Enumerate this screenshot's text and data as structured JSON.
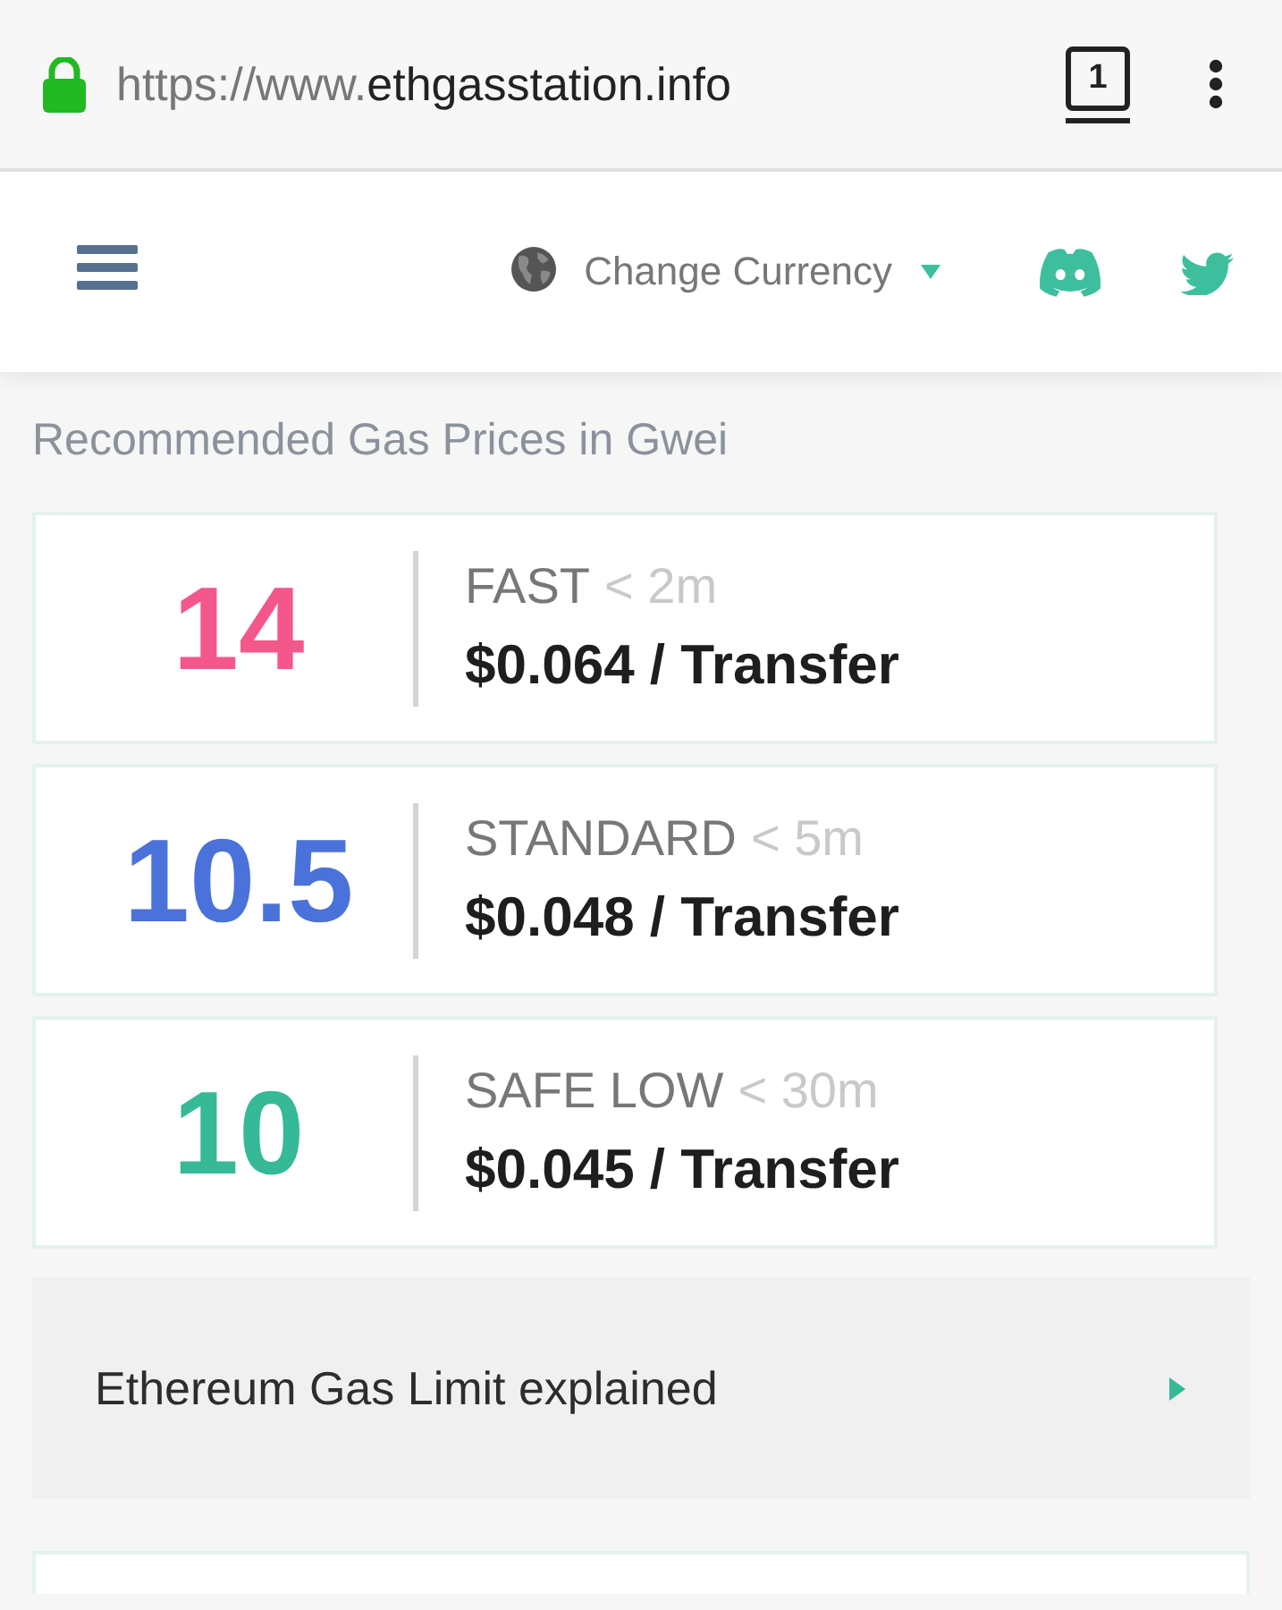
{
  "browser": {
    "url": {
      "prefix": "https://www.",
      "domain": "ethgasstation.info"
    },
    "tab_count": "1"
  },
  "header": {
    "currency_label": "Change Currency"
  },
  "section_title": "Recommended Gas Prices in Gwei",
  "prices": [
    {
      "value": "14",
      "color": "#f4578a",
      "speed": "FAST",
      "time": "< 2m",
      "cost": "$0.064 / Transfer"
    },
    {
      "value": "10.5",
      "color": "#4a72da",
      "speed": "STANDARD",
      "time": "< 5m",
      "cost": "$0.048 / Transfer"
    },
    {
      "value": "10",
      "color": "#35b996",
      "speed": "SAFE LOW",
      "time": "< 30m",
      "cost": "$0.045 / Transfer"
    }
  ],
  "link_card": {
    "label": "Ethereum Gas Limit explained"
  }
}
